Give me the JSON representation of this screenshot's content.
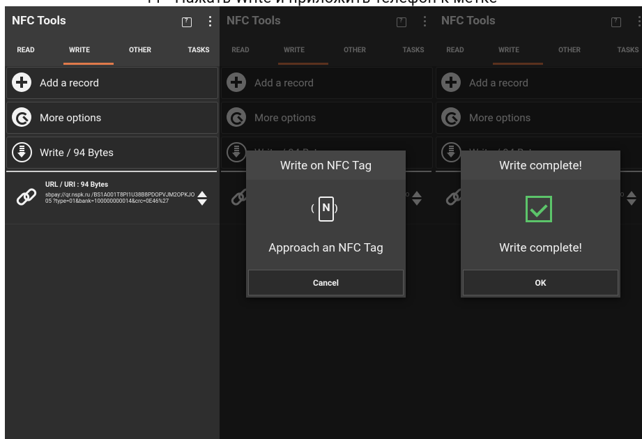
{
  "caption": "11 - Нажать Write и приложить телефон к метке",
  "app": {
    "title": "NFC Tools"
  },
  "tabs": [
    "READ",
    "WRITE",
    "OTHER",
    "TASKS"
  ],
  "actions": [
    "Add a record",
    "More options",
    "Write / 94 Bytes"
  ],
  "record": {
    "title": "URL / URI : 94 Bytes",
    "value": "sbpay://qr.nspk.ru /BS1A001T8PI1U38B8PDOPVJM2OPKJO05 ?type=01&bank=100000000014&crc=0E46%27"
  },
  "dialog_write": {
    "title": "Write on NFC Tag",
    "message": "Approach an NFC Tag",
    "button": "Cancel"
  },
  "dialog_complete": {
    "title": "Write complete!",
    "message": "Write complete!",
    "button": "OK"
  },
  "colors": {
    "accent": "#e07a4b",
    "success": "#5cc46a",
    "background": "#2e2e2e"
  }
}
